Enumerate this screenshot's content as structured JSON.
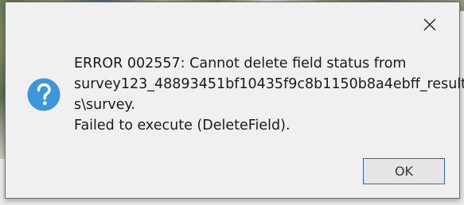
{
  "dialog": {
    "icon": "question-icon",
    "message_lines": [
      "ERROR 002557: Cannot delete field status from",
      "survey123_48893451bf10435f9c8b1150b8a4ebff_result",
      "s\\survey.",
      "Failed to execute (DeleteField)."
    ],
    "ok_label": "OK",
    "close_icon": "close-icon"
  },
  "colors": {
    "dialog_background": "#f0f0f0",
    "icon_blue": "#3a96dd",
    "button_border": "#0078d7"
  }
}
